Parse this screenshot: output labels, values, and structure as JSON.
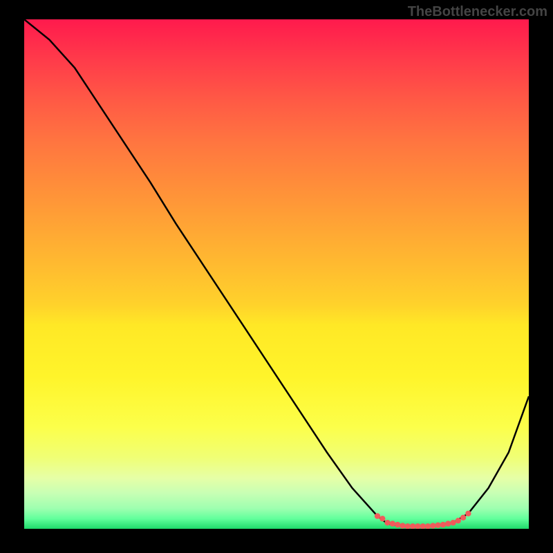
{
  "watermark": "TheBottlenecker.com",
  "chart_data": {
    "type": "line",
    "title": "",
    "xlabel": "",
    "ylabel": "",
    "xlim": [
      0,
      100
    ],
    "ylim": [
      0,
      100
    ],
    "series": [
      {
        "name": "bottleneck-curve",
        "x": [
          0,
          5,
          10,
          15,
          20,
          25,
          30,
          35,
          40,
          45,
          50,
          55,
          60,
          65,
          70,
          72,
          75,
          80,
          85,
          88,
          92,
          96,
          100
        ],
        "y": [
          100,
          96,
          90.5,
          83,
          75.5,
          68,
          60,
          52.5,
          45,
          37.5,
          30,
          22.5,
          15,
          8,
          2.5,
          1,
          0.5,
          0.5,
          1.2,
          3,
          8,
          15,
          26
        ],
        "color": "#000000"
      },
      {
        "name": "sweet-spot-marker",
        "x": [
          70,
          71,
          72,
          73,
          74,
          75,
          76,
          77,
          78,
          79,
          80,
          81,
          82,
          83,
          84,
          85,
          86,
          87,
          88
        ],
        "y": [
          2.5,
          2.0,
          1.2,
          1.0,
          0.8,
          0.6,
          0.5,
          0.5,
          0.5,
          0.5,
          0.5,
          0.6,
          0.7,
          0.8,
          1.0,
          1.2,
          1.6,
          2.2,
          3.0
        ],
        "color": "#f05b5b",
        "style": "dotted-thick"
      }
    ],
    "background_gradient": {
      "type": "vertical",
      "stops": [
        {
          "pos": 0,
          "color": "#ff1a4d"
        },
        {
          "pos": 50,
          "color": "#ffba30"
        },
        {
          "pos": 80,
          "color": "#fcff4a"
        },
        {
          "pos": 100,
          "color": "#1fd96b"
        }
      ]
    }
  }
}
